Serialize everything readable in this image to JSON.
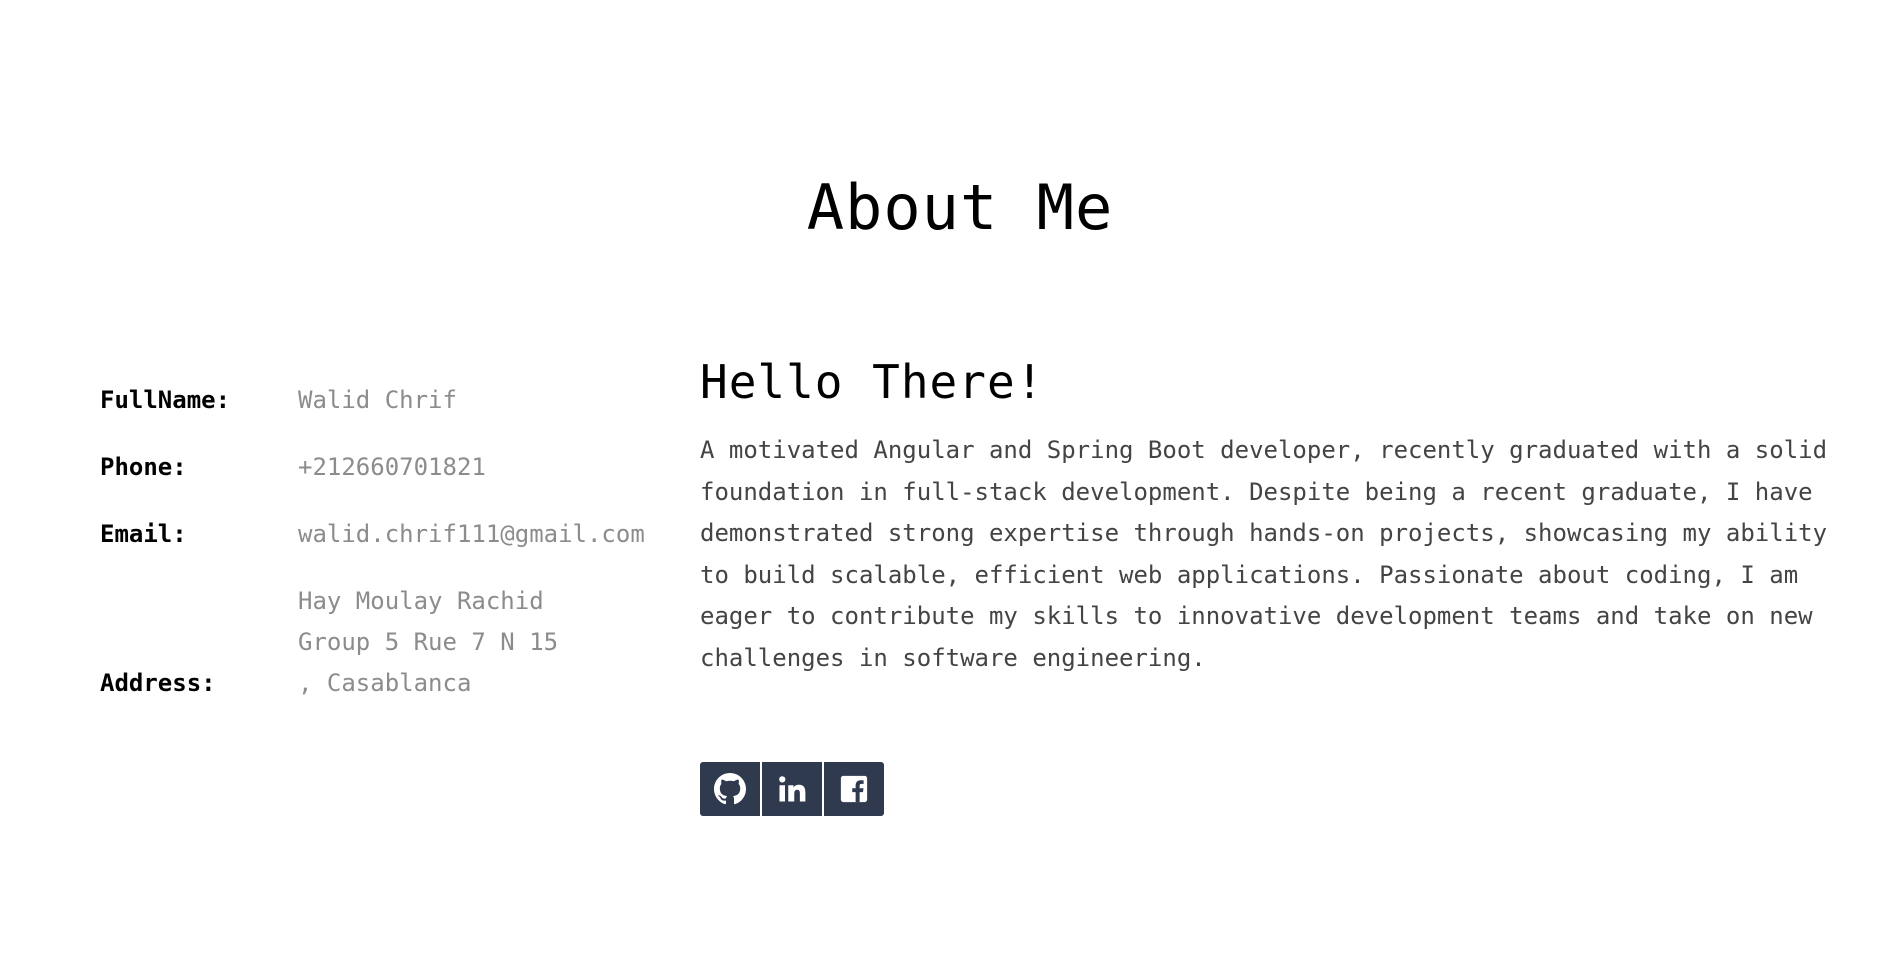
{
  "section": {
    "title": "About Me"
  },
  "info": {
    "fullname_label": "FullName:",
    "fullname_value": "Walid Chrif",
    "phone_label": "Phone:",
    "phone_value": "+212660701821",
    "email_label": "Email:",
    "email_value": "walid.chrif111@gmail.com",
    "address_label": "Address:",
    "address_value": "Hay Moulay Rachid\nGroup 5 Rue 7 N 15\n, Casablanca"
  },
  "bio": {
    "heading": "Hello There!",
    "text": "A motivated Angular and Spring Boot developer, recently graduated with a solid foundation in full-stack development. Despite being a recent graduate, I have demonstrated strong expertise through hands-on projects, showcasing my ability to build scalable, efficient web applications. Passionate about coding, I am eager to contribute my skills to innovative development teams and take on new challenges in software engineering."
  },
  "social": {
    "items": [
      {
        "icon": "github-icon"
      },
      {
        "icon": "linkedin-icon"
      },
      {
        "icon": "facebook-icon"
      }
    ],
    "button_color": "#2f3a4e"
  }
}
